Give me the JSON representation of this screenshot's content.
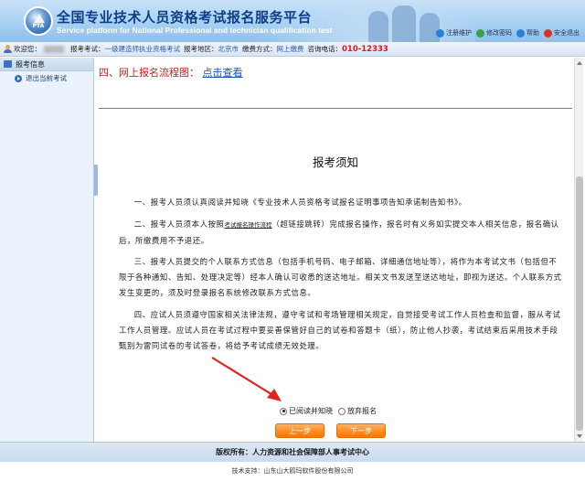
{
  "header": {
    "title": "全国专业技术人员资格考试报名服务平台",
    "subtitle": "Service platform for National Professional and technician qualification test",
    "logo_text": "PTA",
    "links": [
      {
        "label": "注册维护",
        "icon": "user-edit-icon",
        "color": "#2b7fd6"
      },
      {
        "label": "修改密码",
        "icon": "key-icon",
        "color": "#3aa14a"
      },
      {
        "label": "帮助",
        "icon": "help-icon",
        "color": "#2b7fd6"
      },
      {
        "label": "安全退出",
        "icon": "power-icon",
        "color": "#d4322a"
      }
    ]
  },
  "infobar": {
    "welcome": "欢迎您：",
    "exam_label": "报考考试：",
    "exam_value": "一级建造师执业资格考试",
    "region_label": "报考地区：",
    "region_value": "北京市",
    "pay_label": "缴费方式：",
    "pay_value": "网上缴费",
    "phone_label": "咨询电话：",
    "phone_value": "010-12333"
  },
  "sidebar": {
    "header": "报考信息",
    "items": [
      {
        "label": "退出当前考试"
      }
    ]
  },
  "main": {
    "section_title": "四、网上报名流程图：",
    "section_link": "点击查看",
    "notice_title": "报考须知",
    "paragraphs": [
      {
        "before": "一、报考人员须认真阅读并知晓《专业技术人员资格考试报名证明事项告知承诺制告知书》。",
        "link": "",
        "after": ""
      },
      {
        "before": "二、报考人员须本人按照",
        "link": "考试报名操作流程",
        "after": "（超链接跳转）完成报名操作，报名时有义务如实提交本人相关信息，报名确认后，所缴费用不予退还。"
      },
      {
        "before": "三、报考人员提交的个人联系方式信息（包括手机号码、电子邮箱、详细通信地址等），将作为本考试文书（包括但不限于各种通知、告知、处理决定等）经本人确认可收悉的送达地址。相关文书发送至送达地址，即视为送达。个人联系方式发生变更的，须及时登录报名系统修改联系方式信息。",
        "link": "",
        "after": ""
      },
      {
        "before": "四、应试人员须遵守国家相关法律法规，遵守考试和考场管理相关规定，自觉接受考试工作人员检查和监督，服从考试工作人员管理。应试人员在考试过程中要妥善保管好自己的试卷和答题卡（纸），防止他人抄袭，考试结束后采用技术手段甄别为雷同试卷的考试答卷，将给予考试成绩无效处理。",
        "link": "",
        "after": ""
      }
    ],
    "radio_agree": "已阅读并知晓",
    "radio_decline": "放弃报名",
    "agree_selected": true,
    "prev_button": "上一步",
    "next_button": "下一步"
  },
  "footer": {
    "copyright": "版权所有：人力资源和社会保障部人事考试中心",
    "tech_support": "技术支持：山东山大鸥玛软件股份有限公司"
  },
  "colors": {
    "accent_red": "#c8201e",
    "button_orange": "#ff8a1e",
    "header_blue": "#a9d0f2",
    "arrow_red": "#e0241f"
  }
}
